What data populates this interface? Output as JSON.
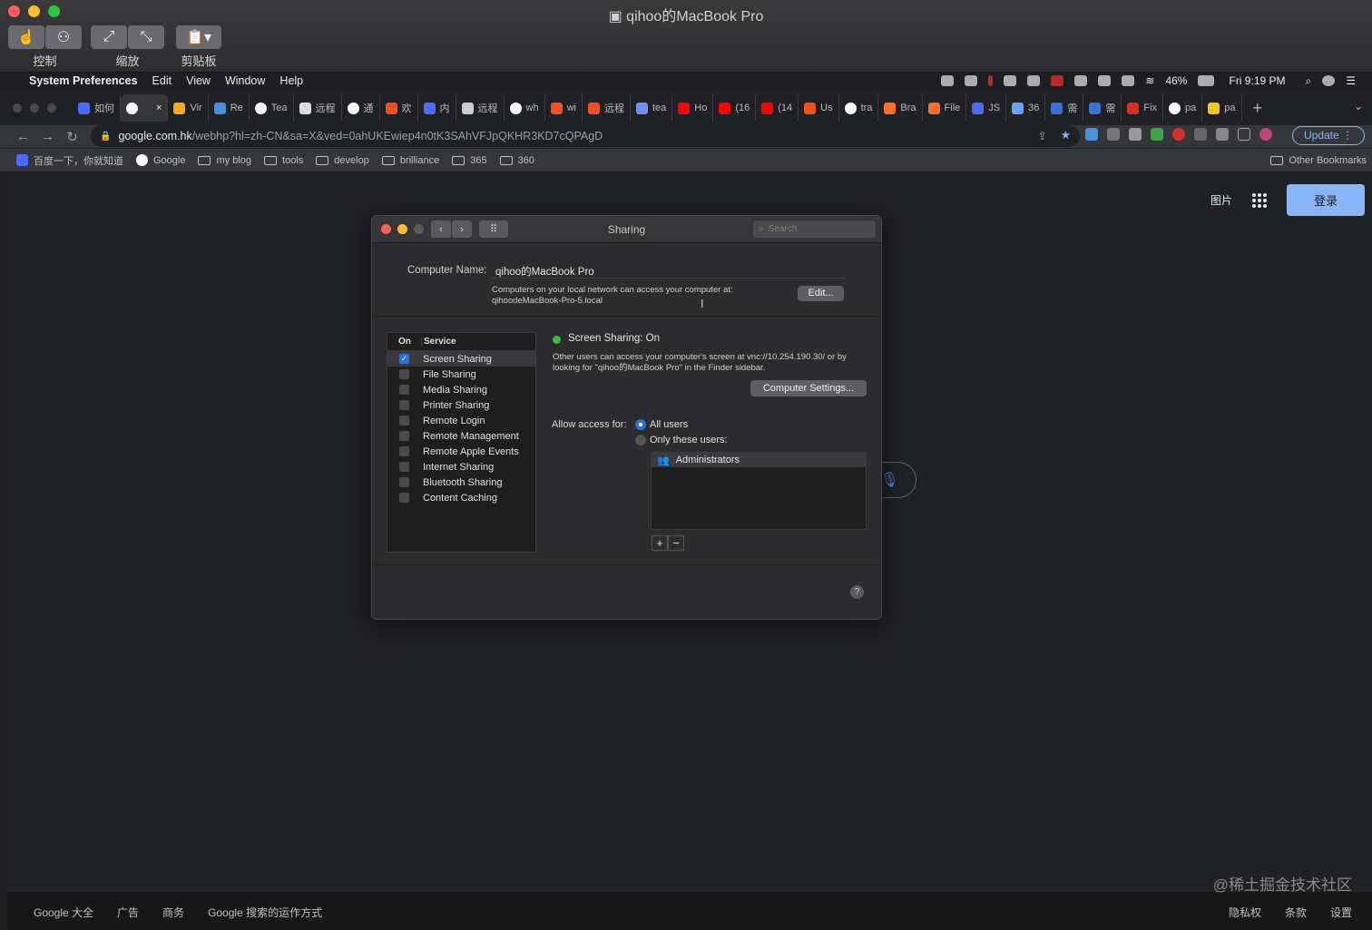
{
  "remote_window": {
    "title": "qihoo的MacBook Pro",
    "toolbar": [
      {
        "label": "控制"
      },
      {
        "label": "缩放"
      },
      {
        "label": "剪贴板"
      }
    ]
  },
  "menubar": {
    "app_name": "System Preferences",
    "items": [
      "Edit",
      "View",
      "Window",
      "Help"
    ],
    "battery": "46%",
    "clock": "Fri 9:19 PM"
  },
  "tabs": [
    {
      "label": "如何",
      "color": "#4a6cf7"
    },
    {
      "label": "",
      "color": "#ffffff",
      "active": true,
      "close": "×"
    },
    {
      "label": "Vir",
      "color": "#f6a623"
    },
    {
      "label": "Re",
      "color": "#4a90d9"
    },
    {
      "label": "Tea",
      "color": "#ffffff"
    },
    {
      "label": "远程",
      "color": "#dddddd"
    },
    {
      "label": "通",
      "color": "#ffffff"
    },
    {
      "label": "欢",
      "color": "#f25022"
    },
    {
      "label": "内",
      "color": "#4a6cf7"
    },
    {
      "label": "远程",
      "color": "#cccccc"
    },
    {
      "label": "wh",
      "color": "#ffffff"
    },
    {
      "label": "wi",
      "color": "#f25022"
    },
    {
      "label": "远程",
      "color": "#f25022"
    },
    {
      "label": "tea",
      "color": "#6c8cff"
    },
    {
      "label": "Ho",
      "color": "#ff0000"
    },
    {
      "label": "(16",
      "color": "#ff0000"
    },
    {
      "label": "(14",
      "color": "#ff0000"
    },
    {
      "label": "Us",
      "color": "#f25022"
    },
    {
      "label": "tra",
      "color": "#ffffff"
    },
    {
      "label": "Bra",
      "color": "#fc6d26"
    },
    {
      "label": "File",
      "color": "#fc6d26"
    },
    {
      "label": "JS",
      "color": "#4a6cf7"
    },
    {
      "label": "36",
      "color": "#6aa0ff"
    },
    {
      "label": "需",
      "color": "#3e6fd6"
    },
    {
      "label": "需",
      "color": "#3e6fd6"
    },
    {
      "label": "Fix",
      "color": "#d93025"
    },
    {
      "label": "pa",
      "color": "#ffffff"
    },
    {
      "label": "pa",
      "color": "#f5c518"
    }
  ],
  "address_bar": {
    "host": "google.com.hk",
    "path": "/webhp?hl=zh-CN&sa=X&ved=0ahUKEwiep4n0tK3SAhVFJpQKHR3KD7cQPAgD",
    "update_label": "Update"
  },
  "bookmarks": [
    {
      "label": "百度一下，你就知道",
      "kind": "site"
    },
    {
      "label": "Google",
      "kind": "site"
    },
    {
      "label": "my blog",
      "kind": "folder"
    },
    {
      "label": "tools",
      "kind": "folder"
    },
    {
      "label": "develop",
      "kind": "folder"
    },
    {
      "label": "brilliance",
      "kind": "folder"
    },
    {
      "label": "365",
      "kind": "folder"
    },
    {
      "label": "360",
      "kind": "folder"
    }
  ],
  "other_bookmarks": "Other Bookmarks",
  "google": {
    "images_link": "图片",
    "login_button": "登录",
    "footer_left": [
      "Google 大全",
      "广告",
      "商务",
      "Google 搜索的运作方式"
    ],
    "footer_right": [
      "隐私权",
      "条款",
      "设置"
    ],
    "watermark": "@稀土掘金技术社区"
  },
  "sharing": {
    "title": "Sharing",
    "search_placeholder": "Search",
    "computer_name_label": "Computer Name:",
    "computer_name_value": "qihoo的MacBook Pro",
    "local_desc_line1": "Computers on your local network can access your computer at:",
    "local_desc_line2": "qihoodeMacBook-Pro-5.local",
    "edit_button": "Edit...",
    "list_header_on": "On",
    "list_header_service": "Service",
    "services": [
      {
        "name": "Screen Sharing",
        "on": true
      },
      {
        "name": "File Sharing",
        "on": false
      },
      {
        "name": "Media Sharing",
        "on": false
      },
      {
        "name": "Printer Sharing",
        "on": false
      },
      {
        "name": "Remote Login",
        "on": false
      },
      {
        "name": "Remote Management",
        "on": false
      },
      {
        "name": "Remote Apple Events",
        "on": false
      },
      {
        "name": "Internet Sharing",
        "on": false
      },
      {
        "name": "Bluetooth Sharing",
        "on": false
      },
      {
        "name": "Content Caching",
        "on": false
      }
    ],
    "status_text": "Screen Sharing: On",
    "status_color": "#32c24b",
    "status_desc": "Other users can access your computer's screen at vnc://10.254.190.30/ or by looking for \"qihoo的MacBook Pro\" in the Finder sidebar.",
    "computer_settings_button": "Computer Settings...",
    "allow_access_label": "Allow access for:",
    "access_options": [
      "All users",
      "Only these users:"
    ],
    "access_selected": "All users",
    "users": [
      "Administrators"
    ],
    "help": "?"
  }
}
